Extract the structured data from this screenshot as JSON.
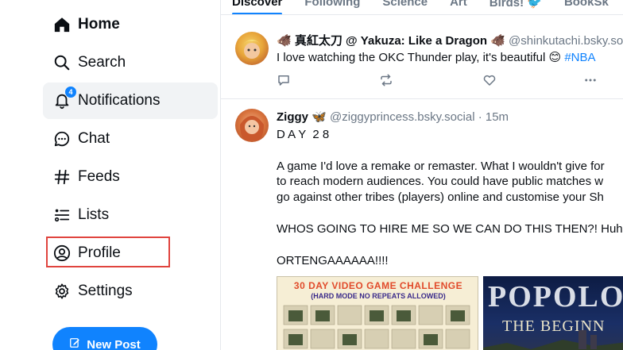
{
  "sidebar": {
    "items": [
      {
        "label": "Home",
        "icon": "home-icon"
      },
      {
        "label": "Search",
        "icon": "search-icon"
      },
      {
        "label": "Notifications",
        "icon": "bell-icon",
        "badge": "4"
      },
      {
        "label": "Chat",
        "icon": "chat-icon"
      },
      {
        "label": "Feeds",
        "icon": "hash-icon"
      },
      {
        "label": "Lists",
        "icon": "list-icon"
      },
      {
        "label": "Profile",
        "icon": "profile-icon"
      },
      {
        "label": "Settings",
        "icon": "gear-icon"
      }
    ],
    "new_post_label": "New Post"
  },
  "tabs": [
    {
      "label": "Discover",
      "active": true
    },
    {
      "label": "Following"
    },
    {
      "label": "Science"
    },
    {
      "label": "Art"
    },
    {
      "label": "Birds! 🐦"
    },
    {
      "label": "BookSk"
    }
  ],
  "posts": [
    {
      "name": "🐗 真紅太刀 @ Yakuza: Like a Dragon 🐗",
      "handle": "@shinkutachi.bsky.social",
      "text": "I love watching the OKC Thunder play, it's beautiful 😊 ",
      "hashtag": "#NBA"
    },
    {
      "name": "Ziggy 🦋",
      "handle": "@ziggyprincess.bsky.social · 15m",
      "lines": [
        "D A Y  2 8",
        "",
        "A game I'd love a remake or remaster. What I wouldn't give for",
        "to reach modern audiences. You could have public matches w",
        "go against other tribes (players) online and customise your Sh",
        "",
        "WHOS GOING TO HIRE ME SO WE CAN DO THIS THEN?! Huh",
        "",
        "ORTENGAAAAAA!!!!"
      ],
      "image_left": {
        "line1": "30 DAY VIDEO GAME CHALLENGE",
        "line2": "(HARD MODE NO REPEATS ALLOWED)"
      },
      "image_right": {
        "line1": "POPOLO",
        "line2": "THE BEGINN"
      }
    }
  ],
  "colors": {
    "accent": "#1083fe",
    "highlight": "#e0443e"
  }
}
